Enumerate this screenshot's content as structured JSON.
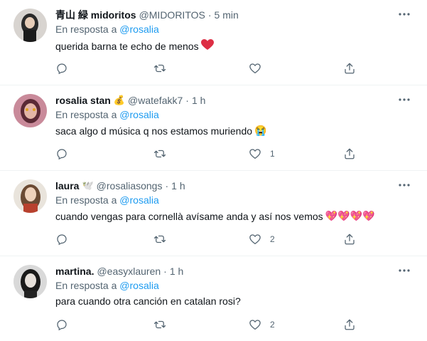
{
  "reply_prefix": "En resposta a",
  "tweets": [
    {
      "name": "青山 緑 midoritos",
      "badge": "",
      "handle": "@MIDORITOS",
      "sep": "·",
      "time": "5 min",
      "mention": "@rosalia",
      "text": "querida barna te echo de menos",
      "emoji": "❤️",
      "reply_count": "",
      "rt_count": "",
      "like_count": "",
      "avatar_color": "#3a3a3a"
    },
    {
      "name": "rosalia stan",
      "badge": "💰",
      "handle": "@watefakk7",
      "sep": "·",
      "time": "1 h",
      "mention": "@rosalia",
      "text": "saca algo d música q nos estamos muriendo",
      "emoji": "😭",
      "reply_count": "",
      "rt_count": "",
      "like_count": "1",
      "avatar_color": "#b07a86"
    },
    {
      "name": "laura",
      "badge": "🕊️",
      "handle": "@rosaliasongs",
      "sep": "·",
      "time": "1 h",
      "mention": "@rosalia",
      "text": "cuando vengas para cornellà avísame anda y así nos vemos",
      "emoji": "💖💖💖💖",
      "reply_count": "",
      "rt_count": "",
      "like_count": "2",
      "avatar_color": "#c9a27a"
    },
    {
      "name": "martina.",
      "badge": "",
      "handle": "@easyxlauren",
      "sep": "·",
      "time": "1 h",
      "mention": "@rosalia",
      "text": "para cuando otra canción en catalan rosi?",
      "emoji": "",
      "reply_count": "",
      "rt_count": "",
      "like_count": "2",
      "avatar_color": "#2c2c2c"
    }
  ],
  "colors": {
    "accent": "#1d9bf0",
    "muted": "#536471",
    "text": "#0f1419",
    "divider": "#eff3f4",
    "heart": "#e0245e"
  }
}
